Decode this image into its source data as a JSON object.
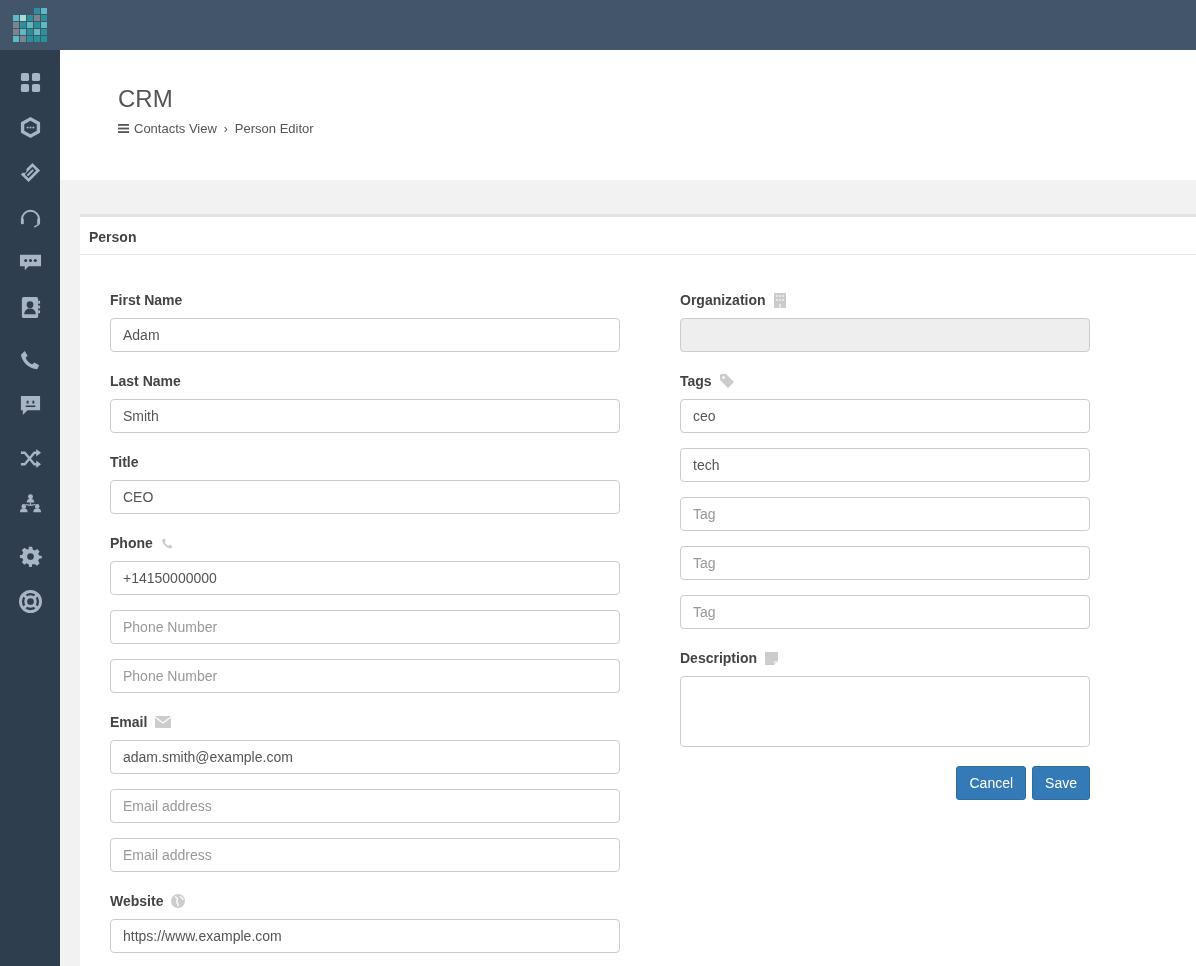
{
  "header": {
    "title": "CRM",
    "separator": "›",
    "breadcrumb": [
      {
        "label": "Contacts View",
        "kind": "menu"
      },
      {
        "label": "Person Editor",
        "kind": "plain"
      }
    ]
  },
  "panel": {
    "title": "Person",
    "left": [
      {
        "label": "First Name",
        "kind": "text",
        "disabled": false,
        "inputs": [
          {
            "value": "Adam"
          }
        ]
      },
      {
        "label": "Last Name",
        "kind": "text",
        "disabled": false,
        "inputs": [
          {
            "value": "Smith"
          }
        ]
      },
      {
        "label": "Title",
        "kind": "text",
        "disabled": false,
        "inputs": [
          {
            "value": "CEO"
          }
        ]
      },
      {
        "label": "Phone",
        "kind": "phone",
        "disabled": false,
        "inputs": [
          {
            "value": "+14150000000"
          },
          {
            "placeholder": "Phone Number"
          },
          {
            "placeholder": "Phone Number"
          }
        ]
      },
      {
        "label": "Email",
        "kind": "email",
        "disabled": false,
        "inputs": [
          {
            "value": "adam.smith@example.com"
          },
          {
            "placeholder": "Email address"
          },
          {
            "placeholder": "Email address"
          }
        ]
      },
      {
        "label": "Website",
        "kind": "website",
        "disabled": false,
        "inputs": [
          {
            "value": "https://www.example.com"
          }
        ]
      }
    ],
    "right": [
      {
        "label": "Organization",
        "kind": "organization",
        "disabled": true
      },
      {
        "label": "Tags",
        "kind": "tags",
        "disabled": false,
        "inputs": [
          {
            "value": "ceo"
          },
          {
            "value": "tech"
          },
          {
            "placeholder": "Tag"
          },
          {
            "placeholder": "Tag"
          },
          {
            "placeholder": "Tag"
          }
        ]
      },
      {
        "label": "Description",
        "kind": "description",
        "disabled": false
      }
    ],
    "buttons": [
      {
        "label": "Cancel"
      },
      {
        "label": "Save"
      }
    ]
  }
}
